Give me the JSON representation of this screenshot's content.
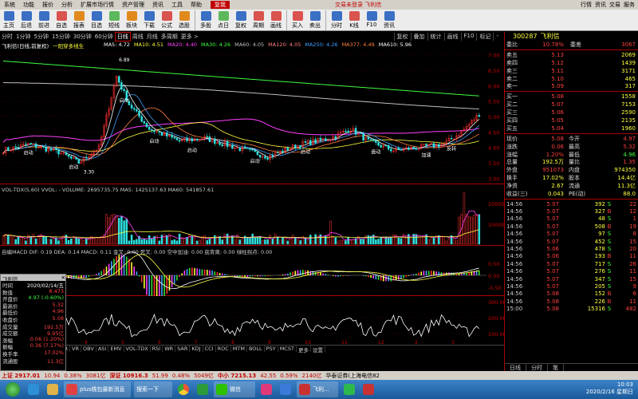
{
  "menubar": {
    "items": [
      "系统",
      "功能",
      "报价",
      "分析",
      "扩展市场行情",
      "资产管理",
      "资讯",
      "工具",
      "帮助"
    ],
    "mode": "复我",
    "title": "交易未登录  飞利信",
    "right_tabs": [
      "行情",
      "资讯",
      "交易",
      "服务"
    ]
  },
  "toolbar": {
    "buttons": [
      {
        "label": "主页",
        "icon": "home-icon",
        "color": "#3a6fc4"
      },
      {
        "label": "后退",
        "icon": "back-icon",
        "color": "#3a6fc4"
      },
      {
        "label": "前进",
        "icon": "forward-icon",
        "color": "#3a6fc4"
      },
      {
        "label": "自选",
        "icon": "star-icon",
        "color": "#d9534f"
      },
      {
        "label": "报表",
        "icon": "report-icon",
        "color": "#e08a1e"
      },
      {
        "label": "目选",
        "icon": "select-icon",
        "color": "#3a6fc4"
      },
      {
        "label": "短线",
        "icon": "short-icon",
        "color": "#5cb85c"
      },
      {
        "label": "板块",
        "icon": "sector-icon",
        "color": "#e08a1e"
      },
      {
        "label": "下载",
        "icon": "download-icon",
        "color": "#3a6fc4"
      },
      {
        "label": "公式",
        "icon": "formula-icon",
        "color": "#d9534f"
      },
      {
        "label": "选股",
        "icon": "screen-icon",
        "color": "#e08a1e"
      },
      {
        "label": "多股",
        "icon": "multi-icon",
        "color": "#3a6fc4"
      },
      {
        "label": "点日",
        "icon": "day-icon",
        "color": "#5cb85c"
      },
      {
        "label": "复权",
        "icon": "adjust-icon",
        "color": "#3a6fc4"
      },
      {
        "label": "周期",
        "icon": "period-icon",
        "color": "#d9534f"
      },
      {
        "label": "画线",
        "icon": "draw-icon",
        "color": "#d9534f"
      },
      {
        "label": "买入",
        "icon": "buy-icon",
        "color": "#d9534f"
      },
      {
        "label": "卖出",
        "icon": "sell-icon",
        "color": "#3a6fc4"
      },
      {
        "label": "分时",
        "icon": "intraday-icon",
        "color": "#3a6fc4"
      },
      {
        "label": "K线",
        "icon": "kline-icon",
        "color": "#d9534f"
      },
      {
        "label": "F10",
        "icon": "f10-icon",
        "color": "#3a6fc4"
      },
      {
        "label": "资讯",
        "icon": "news-icon",
        "color": "#3a6fc4"
      }
    ]
  },
  "periods": {
    "items": [
      "分时",
      "1分钟",
      "5分钟",
      "15分钟",
      "30分钟",
      "60分钟",
      "日线",
      "周线",
      "月线",
      "多周期",
      "更多 >"
    ],
    "active": "日线",
    "right": [
      "复权",
      "叠加",
      "统计",
      "画线",
      "F10",
      "标记",
      "- "
    ]
  },
  "main_chart": {
    "title": "飞利信(日线,前复权)",
    "sub_indicator": "一阳穿多线生",
    "ma_legend": [
      "MA5: 4.72",
      "MA10: 4.51",
      "MA20: 4.40",
      "MA30: 4.26",
      "MA60: 4.05",
      "MA120: 4.05",
      "MA250: 4.26",
      "MA377: 4.49",
      "MA610: 5.96"
    ],
    "price_axis": [
      "7.00",
      "6.50",
      "6.00",
      "5.50",
      "5.00",
      "4.50",
      "4.00",
      "3.50",
      "3.00"
    ],
    "labels": {
      "high": "6.89",
      "low": "3.30",
      "qidong": "启动",
      "fanjue": "反转",
      "jiasu": "加速",
      "pandong": "盘动"
    }
  },
  "volume_chart": {
    "legend": "VOL-TDX(5,60)  VVOL: -  VOLUME: 2695735.75  MA5: 1425137.63  MA60: 541857.61",
    "axis": [
      "20000",
      "10000"
    ],
    "unit": "×10000"
  },
  "macd_chart": {
    "legend": "自编MACD  DIF: 0.19  DEA: 0.14  MACD: 0.11  金叉: 0.00  死叉: 0.00  空中加油: 0.00  底背离: 0.00  绿柱拐点: 0.00",
    "axis": [
      "0.50",
      "0.00",
      "-0.50"
    ]
  },
  "osc_chart": {
    "axis": [
      "300.00",
      "200.00",
      "100.00"
    ]
  },
  "indicator_tabs": [
    "MA",
    "FSL",
    "TRIX",
    "BRAR",
    "CR",
    "VR",
    "OBV",
    "ASI",
    "EMV",
    "VOL-TDX",
    "RSI",
    "WR",
    "SAR",
    "KDJ",
    "CCI",
    "ROC",
    "MTM",
    "BOLL",
    "PSY",
    "MCST",
    "更多",
    "设置"
  ],
  "date_axis": [
    "3",
    "4",
    "5",
    "6",
    "7",
    "8",
    "9",
    "10",
    "11",
    "12",
    "2",
    "3"
  ],
  "info_panel": {
    "title": "飞利信",
    "rows": [
      [
        "时间",
        "2020/02/14/五"
      ],
      [
        "数值",
        "8.473"
      ],
      [
        "开盘价",
        "4.97 (-0.60%)"
      ],
      [
        "最高价",
        "5.32"
      ],
      [
        "最低价",
        "4.96"
      ],
      [
        "收盘价",
        "5.08"
      ],
      [
        "成交量",
        "192.5万"
      ],
      [
        "成交额",
        "9.95亿"
      ],
      [
        "涨幅",
        "0.06 (1.20%)"
      ],
      [
        "振幅",
        "0.36 (7.17%)"
      ],
      [
        "换手率",
        "17.02%"
      ],
      [
        "流通股",
        "11.3亿"
      ]
    ]
  },
  "quote": {
    "code": "300287",
    "name": "飞利信",
    "weibi": [
      "委比",
      "10.78%",
      "委差",
      "3067"
    ],
    "asks": [
      [
        "卖五",
        "5.13",
        "2069"
      ],
      [
        "卖四",
        "5.12",
        "1439"
      ],
      [
        "卖三",
        "5.11",
        "3171"
      ],
      [
        "卖二",
        "5.10",
        "465"
      ],
      [
        "卖一",
        "5.09",
        "317"
      ]
    ],
    "bids": [
      [
        "买一",
        "5.08",
        "1558"
      ],
      [
        "买二",
        "5.07",
        "7153"
      ],
      [
        "买三",
        "5.06",
        "2590"
      ],
      [
        "买四",
        "5.05",
        "2135"
      ],
      [
        "买五",
        "5.04",
        "1960"
      ]
    ],
    "stats": [
      [
        "现价",
        "5.08",
        "今开",
        "4.97"
      ],
      [
        "涨跌",
        "0.06",
        "最高",
        "5.32"
      ],
      [
        "涨幅",
        "1.20%",
        "最低",
        "4.96"
      ],
      [
        "总量",
        "192.5万",
        "量比",
        "1.35"
      ],
      [
        "外盘",
        "951073",
        "内盘",
        "974350"
      ],
      [
        "换手",
        "17.02%",
        "股本",
        "14.4亿"
      ],
      [
        "净资",
        "2.67",
        "流通",
        "11.3亿"
      ],
      [
        "收益(三)",
        "0.043",
        "PE(动)",
        "88.0"
      ]
    ],
    "ticks": [
      [
        "14:56",
        "5.07",
        "392",
        "S",
        "22"
      ],
      [
        "14:56",
        "5.07",
        "327",
        "B",
        "12"
      ],
      [
        "14:56",
        "5.07",
        "48",
        "S",
        "1"
      ],
      [
        "14:56",
        "5.07",
        "508",
        "B",
        "19"
      ],
      [
        "14:56",
        "5.07",
        "97",
        "S",
        "8"
      ],
      [
        "14:56",
        "5.07",
        "452",
        "S",
        "15"
      ],
      [
        "14:56",
        "5.06",
        "478",
        "S",
        "20"
      ],
      [
        "14:56",
        "5.06",
        "193",
        "B",
        "11"
      ],
      [
        "14:56",
        "5.07",
        "717",
        "S",
        "26"
      ],
      [
        "14:56",
        "5.07",
        "276",
        "S",
        "11"
      ],
      [
        "14:56",
        "5.07",
        "347",
        "S",
        "15"
      ],
      [
        "14:56",
        "5.07",
        "205",
        "S",
        "9"
      ],
      [
        "14:56",
        "5.08",
        "152",
        "B",
        "6"
      ],
      [
        "14:56",
        "5.08",
        "226",
        "B",
        "11"
      ],
      [
        "15:00",
        "5.08",
        "15316",
        "S",
        "482"
      ]
    ],
    "side_tabs": [
      "日线",
      "分时",
      "笔"
    ]
  },
  "statusbar": {
    "items": [
      "上证 2917.01",
      "10.94",
      "0.38%",
      "3081亿",
      "深证 10916.3",
      "51.99",
      "0.48%",
      "5049亿",
      "中小 7215.13",
      "42.55",
      "0.59%",
      "2140亿",
      "华泰证券(上海电信82"
    ]
  },
  "taskbar": {
    "items": [
      "plus桃包最新消息",
      "搜索一下",
      "微信",
      "飞利...",
      "同花顺"
    ],
    "clock": "10:03",
    "date": "2020/2/16 星期日"
  }
}
